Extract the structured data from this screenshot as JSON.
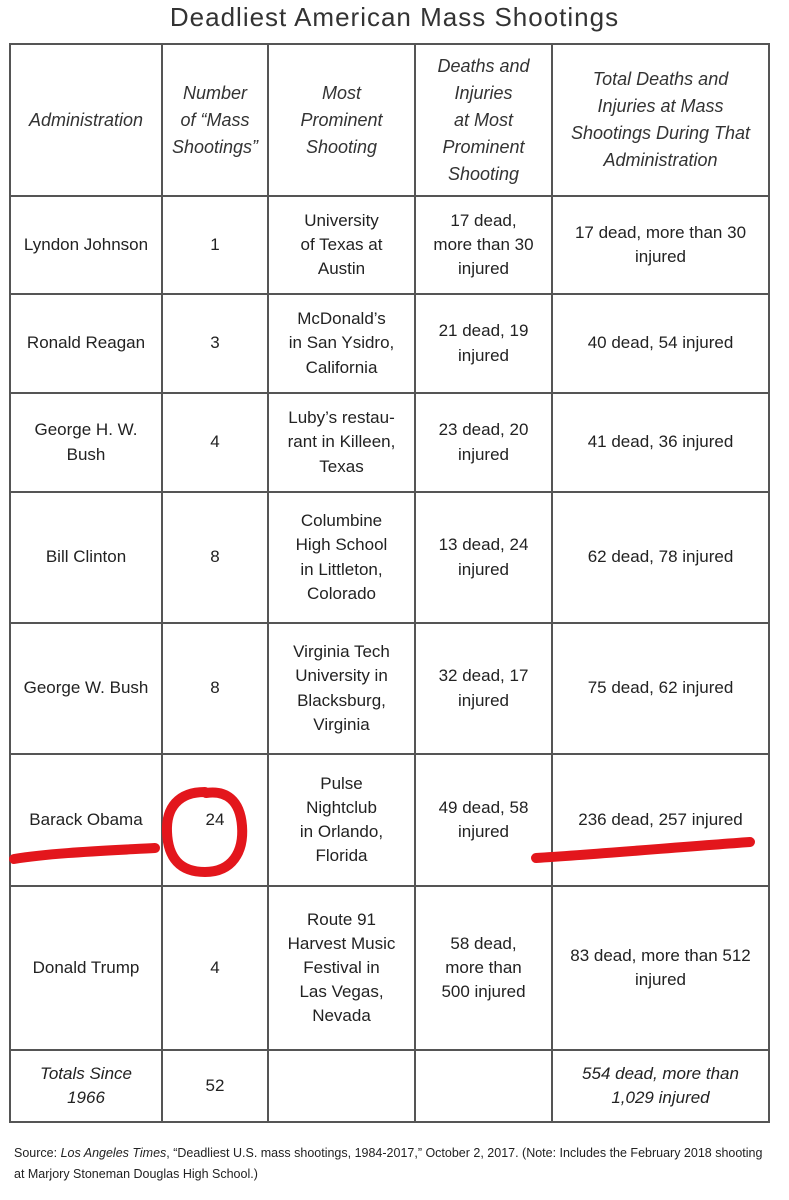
{
  "title": "Deadliest American Mass Shootings",
  "headers": [
    "Administration",
    "Number\nof “Mass\nShootings”",
    "Most\nProminent\nShooting",
    "Deaths and\nInjuries\nat Most\nProminent\nShooting",
    "Total Deaths and\nInjuries at Mass\nShootings During That\nAdministration"
  ],
  "rows": [
    {
      "admin": "Lyndon Johnson",
      "count": "1",
      "shooting": "University\nof Texas at\nAustin",
      "prominent": "17 dead,\nmore than 30\ninjured",
      "total": "17 dead, more than 30\ninjured"
    },
    {
      "admin": "Ronald Reagan",
      "count": "3",
      "shooting": "McDonald’s\nin San Ysidro,\nCalifornia",
      "prominent": "21 dead, 19\ninjured",
      "total": "40 dead, 54 injured"
    },
    {
      "admin": "George H. W.\nBush",
      "count": "4",
      "shooting": "Luby’s restau-\nrant in Killeen,\nTexas",
      "prominent": "23 dead, 20\ninjured",
      "total": "41 dead, 36 injured"
    },
    {
      "admin": "Bill Clinton",
      "count": "8",
      "shooting": "Columbine\nHigh School\nin Littleton,\nColorado",
      "prominent": "13 dead, 24\ninjured",
      "total": "62 dead, 78 injured"
    },
    {
      "admin": "George W. Bush",
      "count": "8",
      "shooting": "Virginia Tech\nUniversity in\nBlacksburg,\nVirginia",
      "prominent": "32 dead, 17\ninjured",
      "total": "75 dead, 62 injured"
    },
    {
      "admin": "Barack Obama",
      "count": "24",
      "shooting": "Pulse\nNightclub\nin Orlando,\nFlorida",
      "prominent": "49 dead, 58\ninjured",
      "total": "236 dead, 257 injured"
    },
    {
      "admin": "Donald Trump",
      "count": "4",
      "shooting": "Route 91\nHarvest Music\nFestival in\nLas Vegas,\nNevada",
      "prominent": "58 dead,\nmore than\n500 injured",
      "total": "83 dead, more than 512\ninjured"
    }
  ],
  "totals": {
    "label": "Totals Since\n1966",
    "count": "52",
    "total": "554 dead, more than\n1,029 injured"
  },
  "source": {
    "prefix": "Source: ",
    "publication": "Los Angeles Times",
    "rest": ", “Deadliest U.S. mass shootings, 1984-2017,” October 2, 2017. (Note: Includes the February 2018 shooting at Marjory Stoneman Douglas High School.)"
  },
  "annotation_color": "#e3161c"
}
